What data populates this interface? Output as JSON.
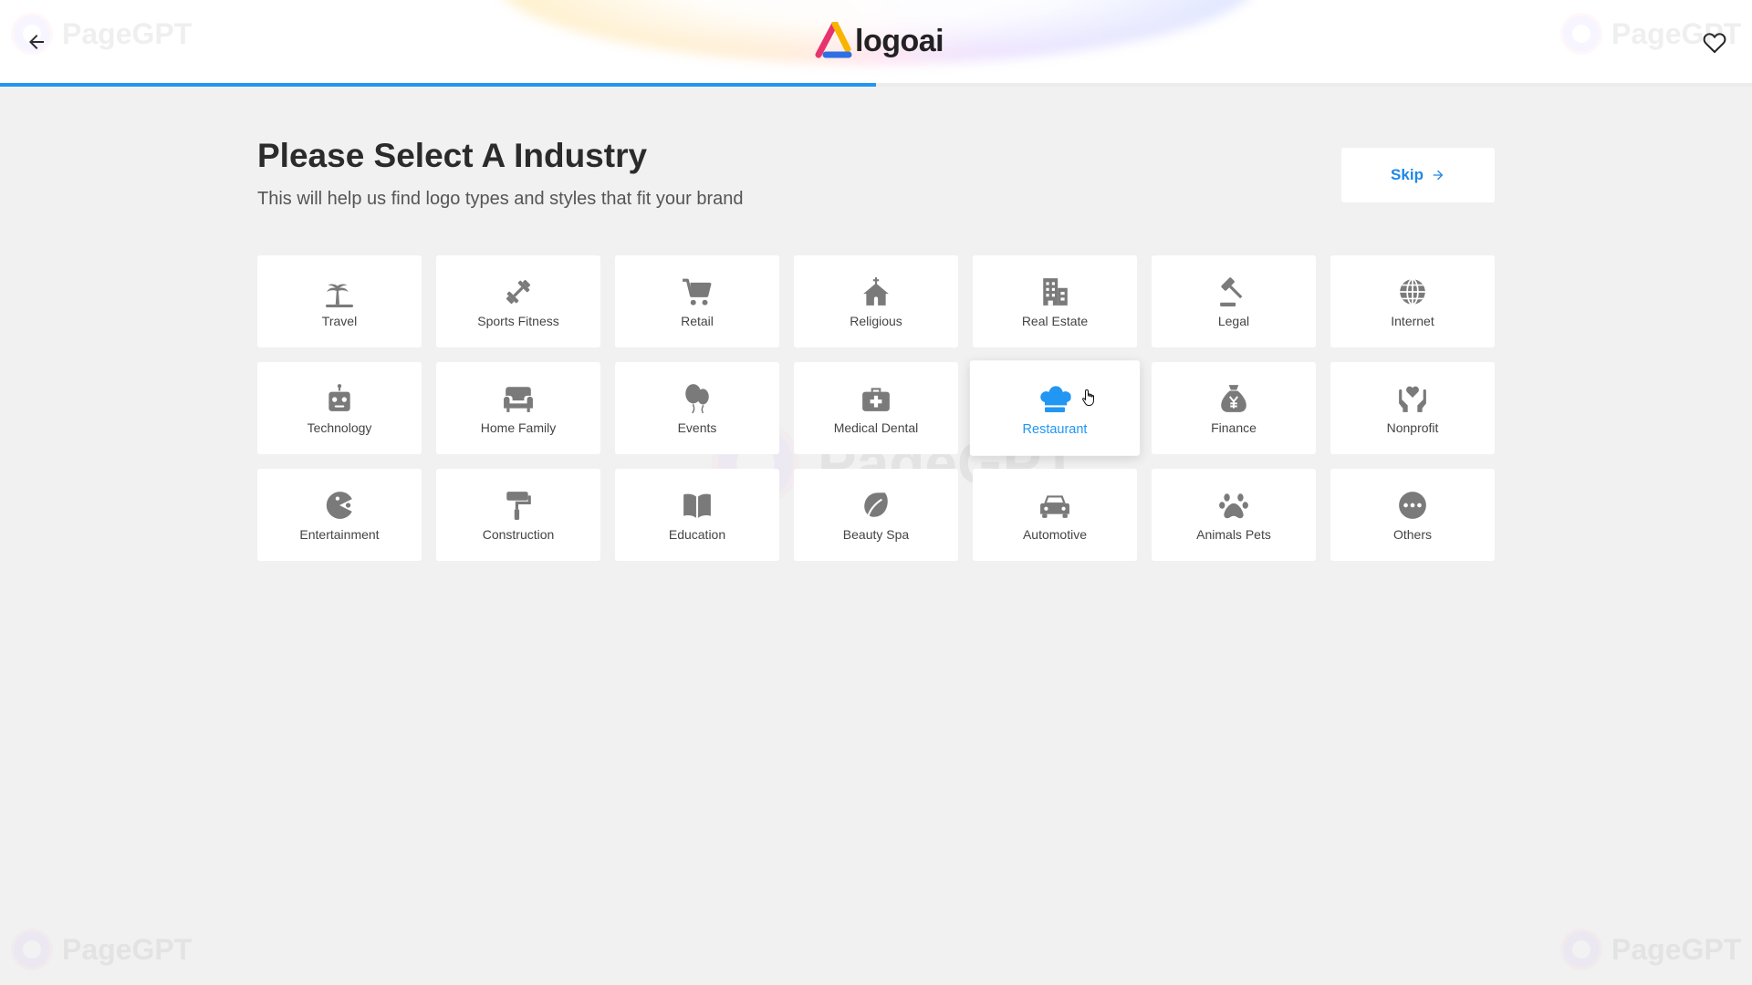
{
  "header": {
    "logo_text": "logoai",
    "back_icon": "arrow-left-icon",
    "favorite_icon": "heart-outline-icon",
    "progress_fraction": 0.5,
    "accent_color": "#2196f3"
  },
  "page": {
    "title": "Please Select A Industry",
    "subtitle": "This will help us find logo types and styles that fit your brand",
    "skip_label": "Skip",
    "skip_icon": "arrow-right-icon"
  },
  "watermark_text": "PageGPT",
  "industries": [
    {
      "label": "Travel",
      "icon": "palm-tree-icon"
    },
    {
      "label": "Sports Fitness",
      "icon": "dumbbell-icon"
    },
    {
      "label": "Retail",
      "icon": "shopping-cart-icon"
    },
    {
      "label": "Religious",
      "icon": "church-icon"
    },
    {
      "label": "Real Estate",
      "icon": "building-icon"
    },
    {
      "label": "Legal",
      "icon": "gavel-icon"
    },
    {
      "label": "Internet",
      "icon": "globe-icon"
    },
    {
      "label": "Technology",
      "icon": "robot-icon"
    },
    {
      "label": "Home Family",
      "icon": "armchair-icon"
    },
    {
      "label": "Events",
      "icon": "balloons-icon"
    },
    {
      "label": "Medical Dental",
      "icon": "medical-kit-icon"
    },
    {
      "label": "Restaurant",
      "icon": "chef-hat-icon",
      "selected": true
    },
    {
      "label": "Finance",
      "icon": "money-bag-icon"
    },
    {
      "label": "Nonprofit",
      "icon": "hands-heart-icon"
    },
    {
      "label": "Entertainment",
      "icon": "pacman-icon"
    },
    {
      "label": "Construction",
      "icon": "paint-roller-icon"
    },
    {
      "label": "Education",
      "icon": "book-open-icon"
    },
    {
      "label": "Beauty Spa",
      "icon": "leaf-spa-icon"
    },
    {
      "label": "Automotive",
      "icon": "car-icon"
    },
    {
      "label": "Animals Pets",
      "icon": "paw-icon"
    },
    {
      "label": "Others",
      "icon": "more-dots-icon"
    }
  ]
}
